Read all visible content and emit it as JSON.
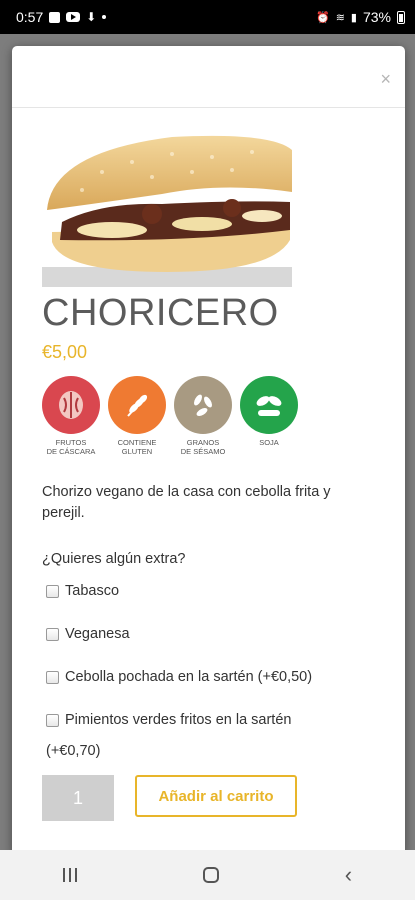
{
  "status_bar": {
    "time": "0:57",
    "battery": "73%"
  },
  "modal": {
    "close_label": "×"
  },
  "product": {
    "name": "CHORICERO",
    "price": "€5,00",
    "description": "Chorizo vegano de la casa con cebolla frita y perejil."
  },
  "allergens": [
    {
      "label": "FRUTOS\nDE CÁSCARA",
      "color": "#d9474f",
      "icon": "nut-icon"
    },
    {
      "label": "CONTIENE\nGLUTEN",
      "color": "#ef7a32",
      "icon": "wheat-icon"
    },
    {
      "label": "GRANOS\nDE SÉSAMO",
      "color": "#a89a82",
      "icon": "sesame-icon"
    },
    {
      "label": "SOJA",
      "color": "#24a44b",
      "icon": "soy-icon"
    }
  ],
  "extras": {
    "title": "¿Quieres algún extra?",
    "options": [
      {
        "label": "Tabasco"
      },
      {
        "label": "Veganesa"
      },
      {
        "label": "Cebolla pochada en la sartén (+€0,50)"
      },
      {
        "label": "Pimientos verdes fritos en la sartén",
        "continuation": "(+€0,70)"
      }
    ]
  },
  "cart": {
    "quantity": "1",
    "add_label": "Añadir al carrito"
  },
  "colors": {
    "accent": "#e8b52a",
    "title": "#5b5b5b"
  }
}
